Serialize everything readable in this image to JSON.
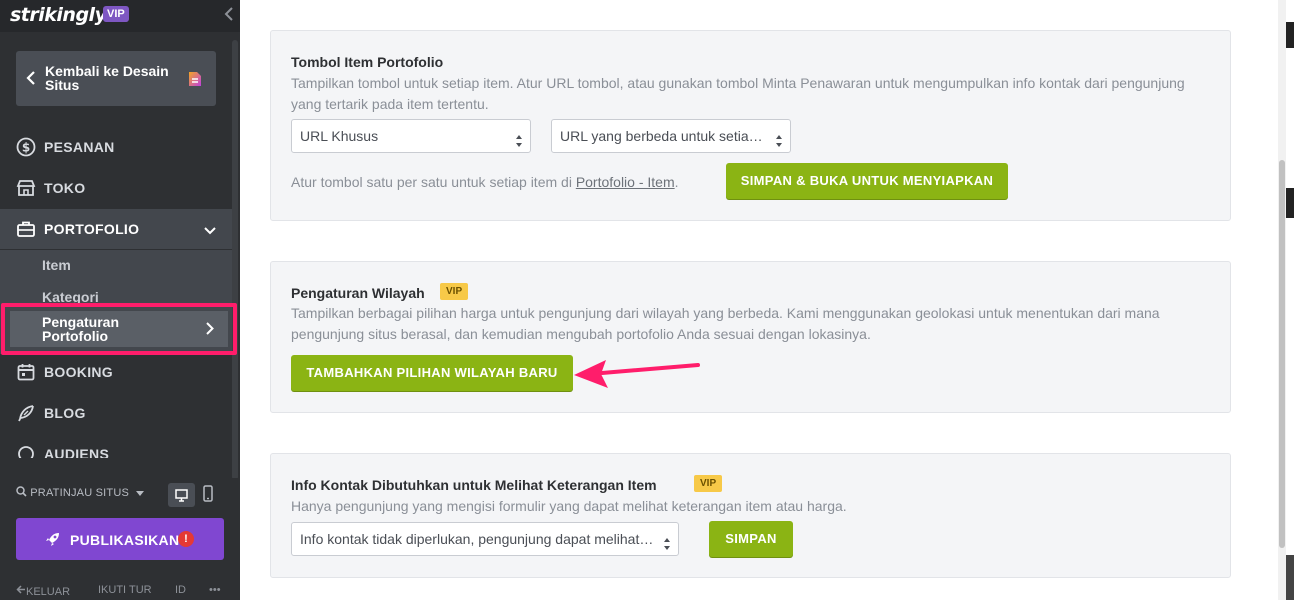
{
  "sidebar": {
    "logo": "strikingly",
    "vip_badge": "VIP",
    "back_label": "Kembali ke Desain Situs",
    "nav": {
      "pesanan": "PESANAN",
      "toko": "TOKO",
      "portofolio": "PORTOFOLIO",
      "booking": "BOOKING",
      "blog": "BLOG",
      "audiens": "AUDIENS"
    },
    "submenu": {
      "item": "Item",
      "kategori": "Kategori",
      "pengaturan": "Pengaturan Portofolio"
    },
    "preview_label": "PRATINJAU SITUS",
    "publish_label": "PUBLIKASIKAN",
    "publish_alert": "!",
    "footer": {
      "keluar": "KELUAR",
      "ikuti_tur": "IKUTI TUR",
      "lang": "ID",
      "more": "•••"
    }
  },
  "cards": {
    "tombol": {
      "title": "Tombol Item Portofolio",
      "desc": "Tampilkan tombol untuk setiap item. Atur URL tombol, atau gunakan tombol Minta Penawaran untuk mengumpulkan info kontak dari pengunjung yang tertarik pada item tertentu.",
      "select1": "URL Khusus",
      "select2": "URL yang berbeda untuk setiap item",
      "helper_prefix": "Atur tombol satu per satu untuk setiap item di ",
      "helper_link": "Portofolio - Item",
      "helper_suffix": ".",
      "button": "SIMPAN & BUKA UNTUK MENYIAPKAN"
    },
    "wilayah": {
      "title": "Pengaturan Wilayah",
      "vip": "VIP",
      "desc": "Tampilkan berbagai pilihan harga untuk pengunjung dari wilayah yang berbeda. Kami menggunakan geolokasi untuk menentukan dari mana pengunjung situs berasal, dan kemudian mengubah portofolio Anda sesuai dengan lokasinya.",
      "button": "TAMBAHKAN PILIHAN WILAYAH BARU"
    },
    "kontak": {
      "title": "Info Kontak Dibutuhkan untuk Melihat Keterangan Item",
      "vip": "VIP",
      "desc": "Hanya pengunjung yang mengisi formulir yang dapat melihat keterangan item atau harga.",
      "select": "Info kontak tidak diperlukan, pengunjung dapat melihat keterangan item",
      "button": "SIMPAN"
    }
  },
  "colors": {
    "sidebar_bg": "#2e3033",
    "accent_green": "#8bb414",
    "publish_purple": "#8047d1",
    "highlight_pink": "#ff1d6b",
    "vip_yellow": "#f7c948"
  }
}
